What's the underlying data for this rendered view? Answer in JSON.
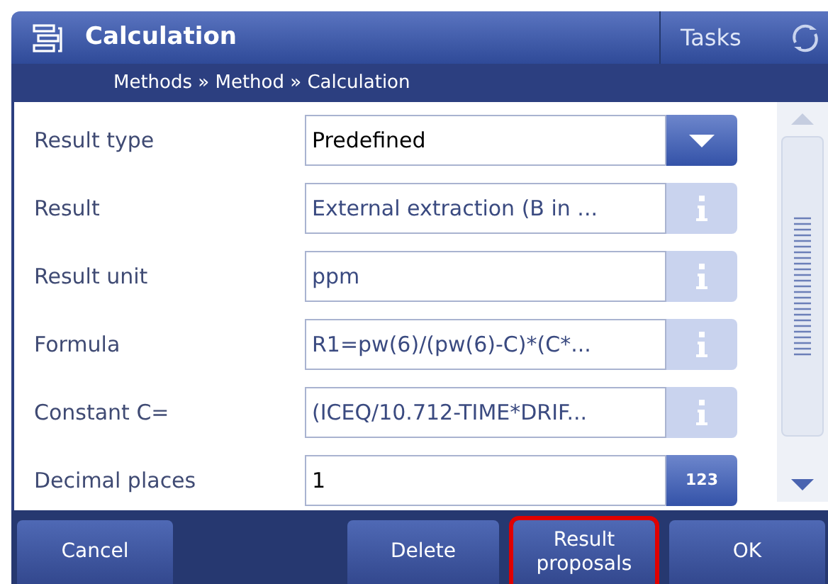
{
  "header": {
    "title": "Calculation",
    "tasks_label": "Tasks"
  },
  "breadcrumb": "Methods » Method » Calculation",
  "fields": [
    {
      "label": "Result type",
      "value": "Predefined",
      "kind": "dropdown"
    },
    {
      "label": "Result",
      "value": "External extraction (B in ...",
      "kind": "info"
    },
    {
      "label": "Result unit",
      "value": "ppm",
      "kind": "info"
    },
    {
      "label": "Formula",
      "value": "R1=pw(6)/(pw(6)-C)*(C*...",
      "kind": "info"
    },
    {
      "label": "Constant C=",
      "value": "(ICEQ/10.712-TIME*DRIF...",
      "kind": "info"
    },
    {
      "label": "Decimal places",
      "value": "1",
      "kind": "number",
      "button_label": "123"
    }
  ],
  "buttons": [
    {
      "label": "Cancel",
      "highlighted": false
    },
    {
      "label": "Delete",
      "highlighted": false
    },
    {
      "label": "Result proposals",
      "highlighted": true
    },
    {
      "label": "OK",
      "highlighted": false
    }
  ]
}
